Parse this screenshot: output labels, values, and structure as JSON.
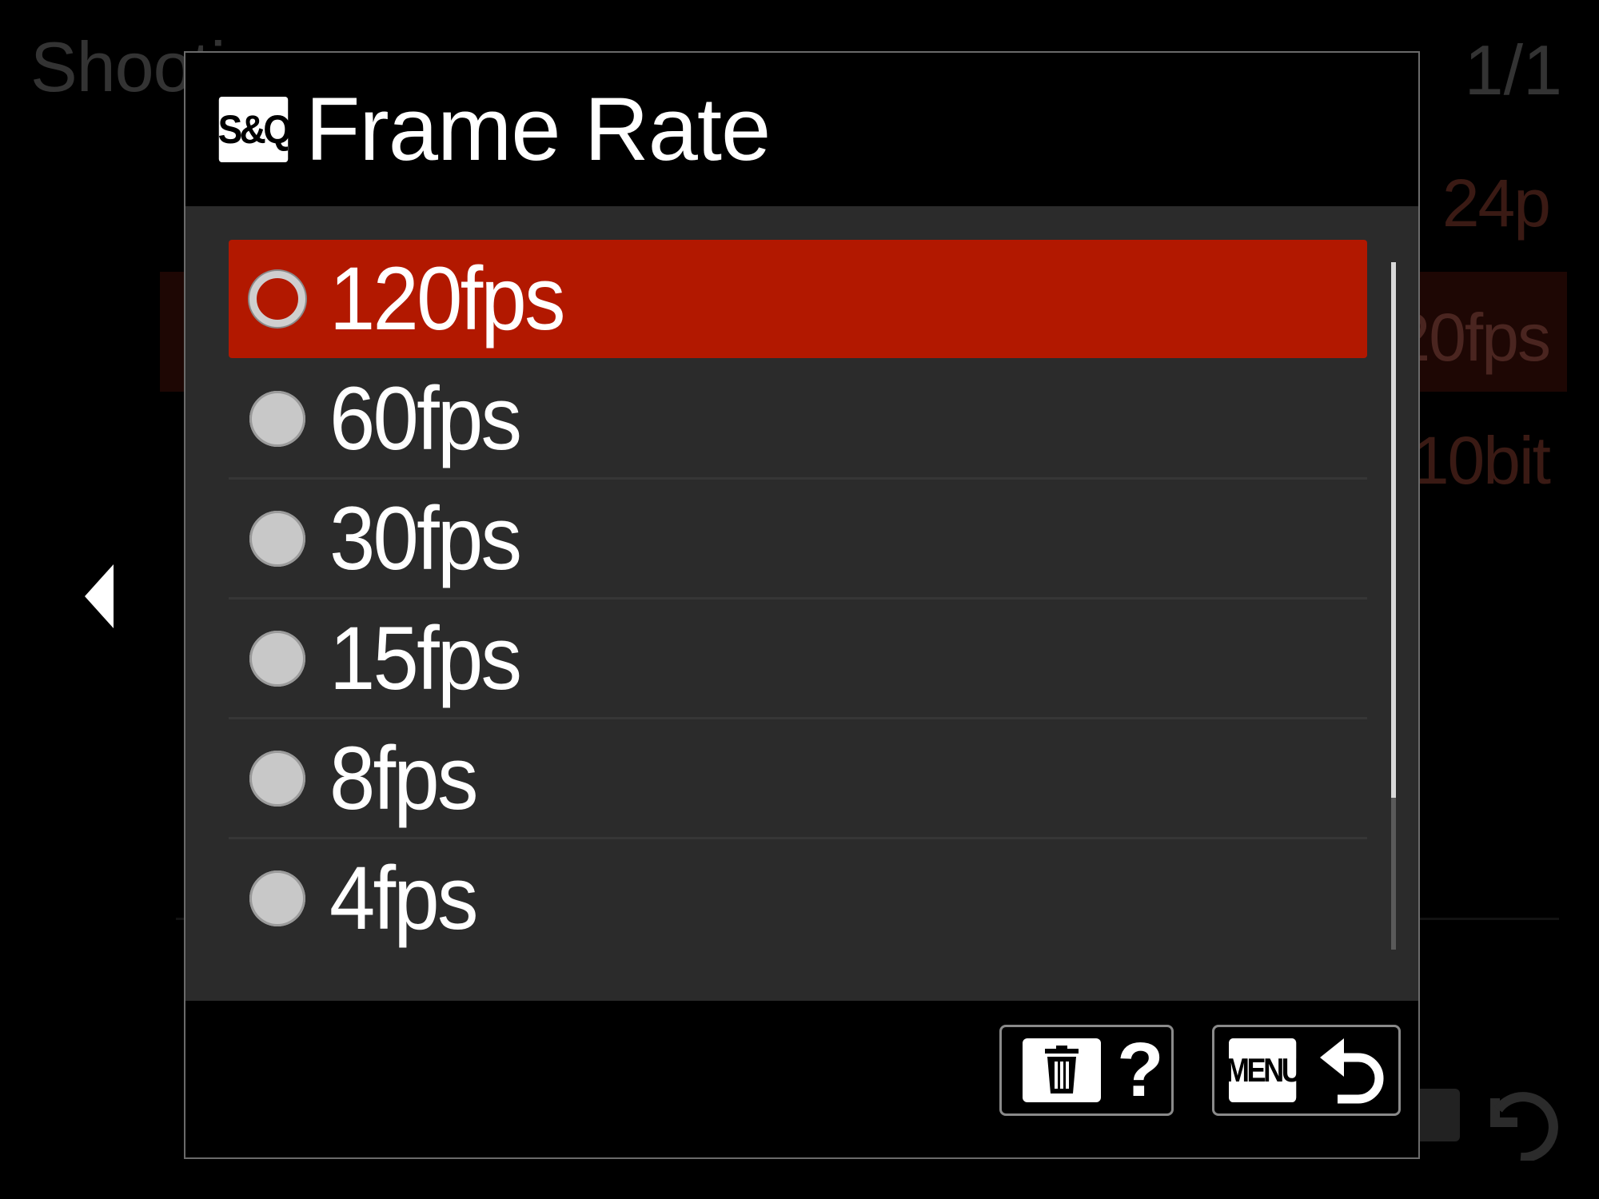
{
  "background_menu": {
    "title": "Shooti",
    "page_indicator": "1/1",
    "values": [
      "24p",
      "20fps",
      "10bit"
    ]
  },
  "dialog": {
    "badge": "S&Q",
    "title": "Frame Rate",
    "selected_index": 0,
    "options": [
      {
        "label": "120fps"
      },
      {
        "label": "60fps"
      },
      {
        "label": "30fps"
      },
      {
        "label": "15fps"
      },
      {
        "label": "8fps"
      },
      {
        "label": "4fps"
      }
    ],
    "footer": {
      "help_symbol": "?",
      "menu_label": "MENU"
    }
  },
  "colors": {
    "selection": "#b21800",
    "panel": "#2b2b2b",
    "background": "#000000",
    "text": "#ffffff"
  },
  "icons": {
    "badge": "sq-badge-icon",
    "delete": "trash-icon",
    "help": "question-icon",
    "back": "return-arrow-icon",
    "nav_left": "left-arrow-icon"
  }
}
